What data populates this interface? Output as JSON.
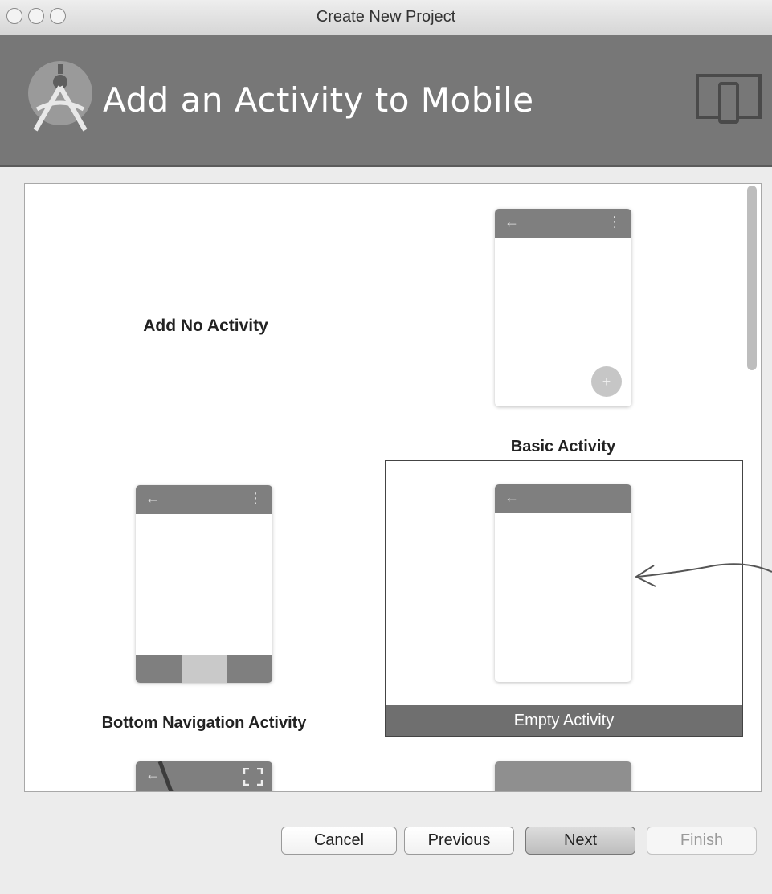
{
  "window": {
    "title": "Create New Project"
  },
  "header": {
    "title": "Add an Activity to Mobile"
  },
  "gallery": {
    "items": [
      {
        "label": "Add No Activity"
      },
      {
        "label": "Basic Activity"
      },
      {
        "label": "Bottom Navigation Activity"
      },
      {
        "label": "Empty Activity",
        "selected": true
      },
      {
        "label": ""
      },
      {
        "label": ""
      }
    ]
  },
  "buttons": {
    "cancel": "Cancel",
    "previous": "Previous",
    "next": "Next",
    "finish": "Finish"
  },
  "icons": {
    "back": "←",
    "overflow_menu": "⋮",
    "fab_add": "+"
  },
  "colors": {
    "header_bg": "#777777",
    "toolbar": "#7f7f7f",
    "selected_caption_bg": "#6f6f6f"
  }
}
